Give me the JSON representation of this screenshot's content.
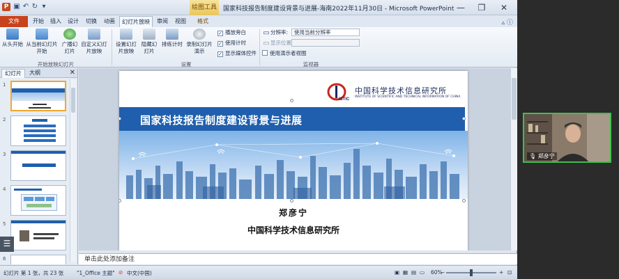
{
  "window": {
    "title": "国家科技报告制度建设背景与进展-海南2022年11月30日 - Microsoft PowerPoint",
    "context_group": "绘图工具"
  },
  "tabs": [
    {
      "label": "文件"
    },
    {
      "label": "开始"
    },
    {
      "label": "插入"
    },
    {
      "label": "设计"
    },
    {
      "label": "切换"
    },
    {
      "label": "动画"
    },
    {
      "label": "幻灯片放映"
    },
    {
      "label": "审阅"
    },
    {
      "label": "视图"
    },
    {
      "label": "格式"
    }
  ],
  "ribbon": {
    "start_show": {
      "from_beginning": "从头开始",
      "from_current": "从当前幻灯片开始",
      "broadcast": "广播幻灯片",
      "custom": "自定义幻灯片放映",
      "group_label": "开始放映幻灯片"
    },
    "setup": {
      "setup_show": "设置幻灯片放映",
      "hide_slide": "隐藏幻灯片",
      "rehearse": "排练计时",
      "record": "录制幻灯片演示",
      "play_narrations": "播放旁白",
      "use_timings": "使用计时",
      "show_media_controls": "显示媒体控件",
      "group_label": "设置"
    },
    "monitors": {
      "resolution_label": "分辨率:",
      "resolution_value": "使用当前分辨率",
      "show_on_label": "显示位置:",
      "presenter_view": "使用演示者视图",
      "group_label": "监视器"
    }
  },
  "left_panel": {
    "tab_slides": "幻灯片",
    "tab_outline": "大纲",
    "thumbnail_numbers": [
      "1",
      "2",
      "3",
      "4",
      "5",
      "6"
    ]
  },
  "slide": {
    "logo_cn": "中国科学技术信息研究所",
    "logo_en": "INSTITUTE OF SCIENTIFIC AND TECHNICAL INFORMATION OF CHINA",
    "logo_mark": "ISTIC",
    "title": "国家科技报告制度建设背景与进展",
    "author": "郑彦宁",
    "institute": "中国科学技术信息研究所"
  },
  "notes": {
    "placeholder": "单击此处添加备注"
  },
  "status": {
    "slide_info": "幻灯片 第 1 张，共 23 张",
    "theme": "\"1_Office 主题\"",
    "language": "中文(中国)",
    "zoom": "60%"
  },
  "webcam": {
    "name": "郑彦宁"
  },
  "colors": {
    "banner": "#1f5fad",
    "file_tab": "#c8421b",
    "webcam_border": "#3fbf4a"
  }
}
